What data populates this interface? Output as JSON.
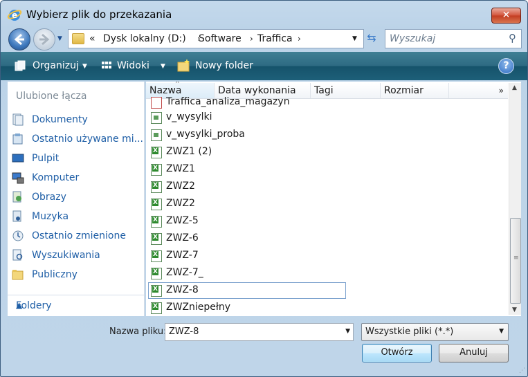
{
  "window": {
    "title": "Wybierz plik do przekazania",
    "close_label": "✕"
  },
  "nav": {
    "address_prefix": "«",
    "address_parts": [
      "Dysk lokalny (D:)",
      "Software",
      "Traffica"
    ],
    "separator": "›",
    "search_placeholder": "Wyszukaj"
  },
  "toolbar": {
    "organize": "Organizuj",
    "views": "Widoki",
    "new_folder": "Nowy folder",
    "help": "?"
  },
  "sidebar": {
    "favorites_header": "Ulubione łącza",
    "items": [
      {
        "label": "Dokumenty",
        "icon": "documents-icon"
      },
      {
        "label": "Ostatnio używane mi...",
        "icon": "recent-places-icon"
      },
      {
        "label": "Pulpit",
        "icon": "desktop-icon"
      },
      {
        "label": "Komputer",
        "icon": "computer-icon"
      },
      {
        "label": "Obrazy",
        "icon": "pictures-icon"
      },
      {
        "label": "Muzyka",
        "icon": "music-icon"
      },
      {
        "label": "Ostatnio zmienione",
        "icon": "recently-changed-icon"
      },
      {
        "label": "Wyszukiwania",
        "icon": "searches-icon"
      },
      {
        "label": "Publiczny",
        "icon": "public-folder-icon"
      }
    ],
    "folders_label": "Foldery"
  },
  "columns": [
    "Nazwa",
    "Data wykonania",
    "Tagi",
    "Rozmiar"
  ],
  "files": [
    {
      "name": "Traffica_analiza_magazyn",
      "type": "pdf"
    },
    {
      "name": "v_wysylki",
      "type": "doc"
    },
    {
      "name": "v_wysylki_proba",
      "type": "doc"
    },
    {
      "name": "ZWZ1 (2)",
      "type": "xl"
    },
    {
      "name": "ZWZ1",
      "type": "xl"
    },
    {
      "name": "ZWZ2",
      "type": "xl"
    },
    {
      "name": "ZWZ2",
      "type": "xl"
    },
    {
      "name": "ZWZ-5",
      "type": "xl"
    },
    {
      "name": "ZWZ-6",
      "type": "xl"
    },
    {
      "name": "ZWZ-7",
      "type": "xl"
    },
    {
      "name": "ZWZ-7_",
      "type": "xl"
    },
    {
      "name": "ZWZ-8",
      "type": "xl",
      "selected": true
    },
    {
      "name": "ZWZniepełny",
      "type": "xl"
    }
  ],
  "footer": {
    "filename_label": "Nazwa pliku:",
    "filename_value": "ZWZ-8",
    "filetype_value": "Wszystkie pliki (*.*)",
    "open_button": "Otwórz",
    "cancel_button": "Anuluj"
  }
}
